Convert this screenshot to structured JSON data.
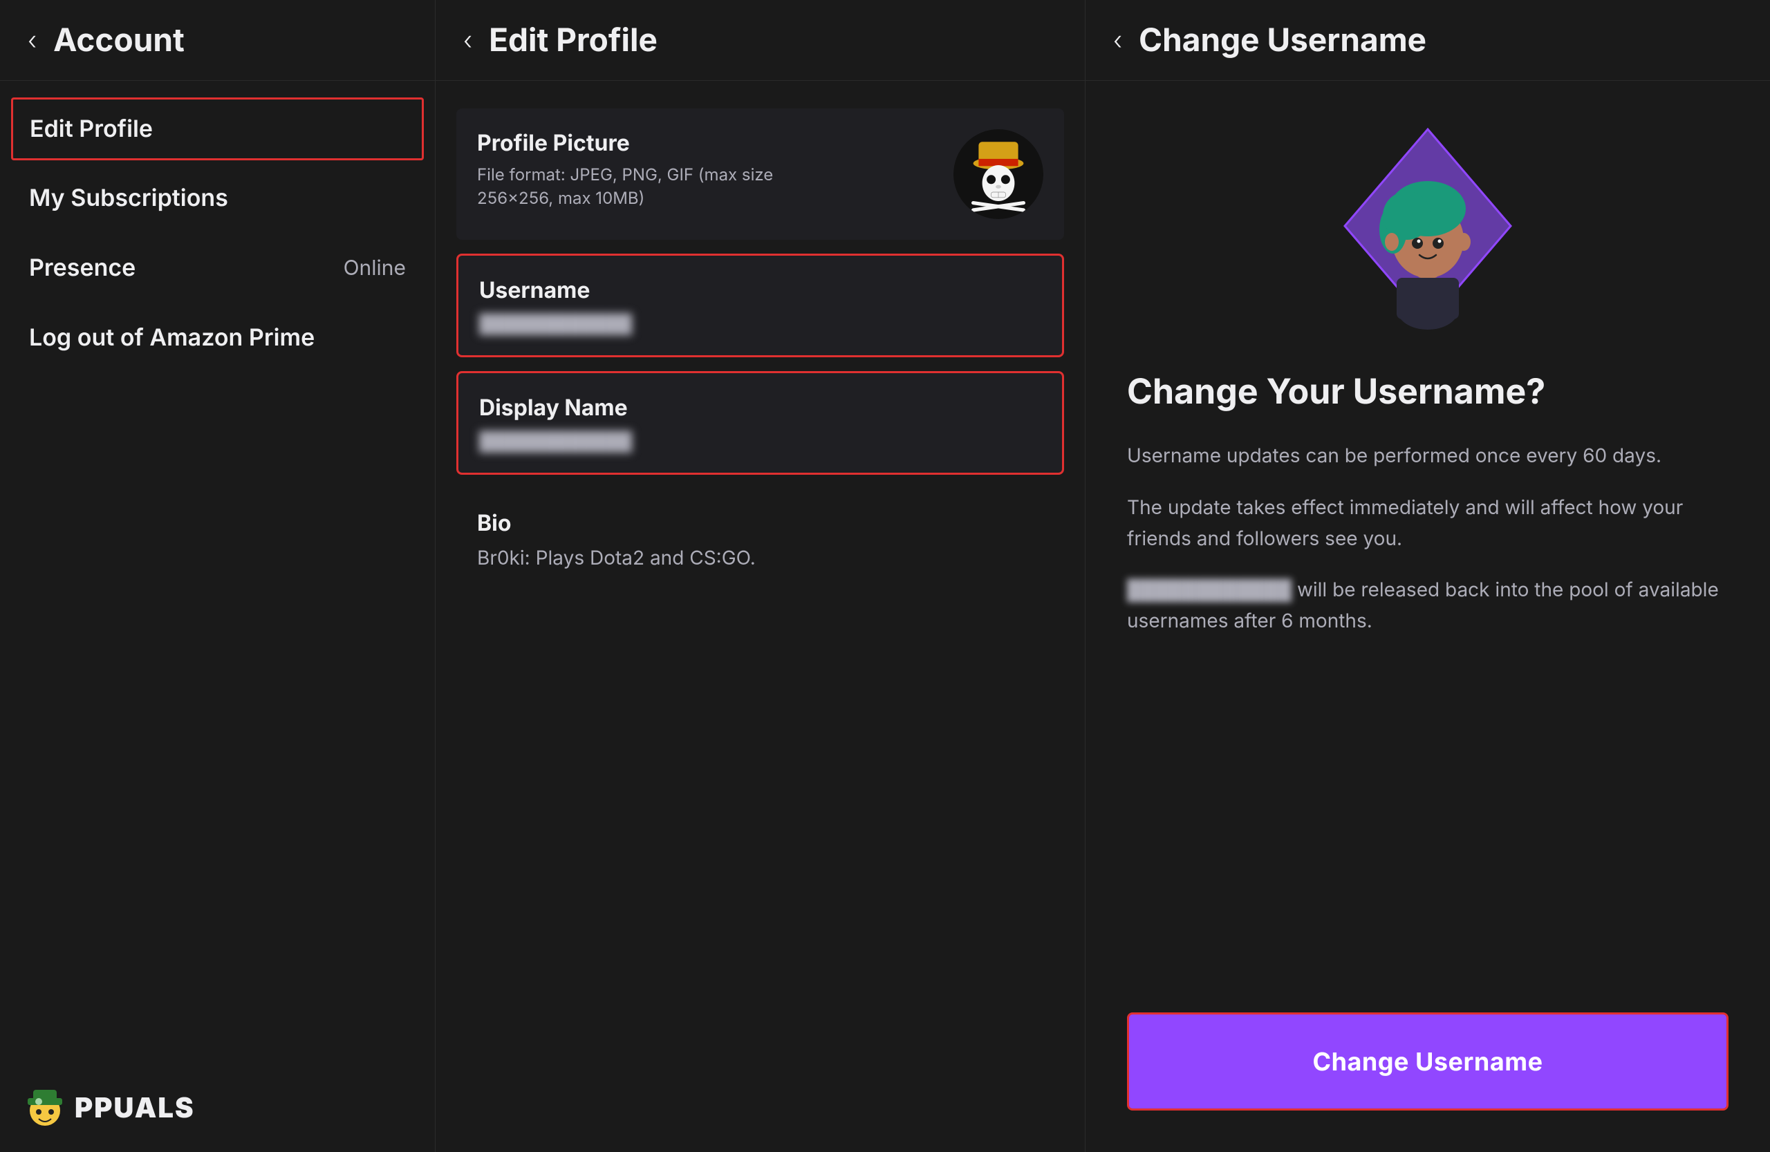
{
  "account_panel": {
    "back_label": "‹",
    "title": "Account",
    "menu_items": [
      {
        "label": "Edit Profile",
        "value": "",
        "active": true
      },
      {
        "label": "My Subscriptions",
        "value": "",
        "active": false
      },
      {
        "label": "Presence",
        "value": "Online",
        "active": false
      },
      {
        "label": "Log out of Amazon Prime",
        "value": "",
        "active": false
      }
    ]
  },
  "edit_profile_panel": {
    "back_label": "‹",
    "title": "Edit Profile",
    "profile_picture": {
      "label": "Profile Picture",
      "description": "File format: JPEG, PNG, GIF (max size 256x256, max 10MB)"
    },
    "username": {
      "label": "Username",
      "blurred_value": "████████████"
    },
    "display_name": {
      "label": "Display Name",
      "blurred_value": "████████████"
    },
    "bio": {
      "label": "Bio",
      "value": "Br0ki: Plays Dota2 and CS:GO."
    }
  },
  "change_username_panel": {
    "back_label": "‹",
    "title": "Change Username",
    "heading": "Change Your Username?",
    "paragraph1": "Username updates can be performed once every 60 days.",
    "paragraph2": "The update takes effect immediately and will affect how your friends and followers see you.",
    "paragraph3_prefix": "",
    "blurred_name": "████████████",
    "paragraph3_suffix": " will be released back into the pool of available usernames after 6 months.",
    "button_label": "Change Username"
  },
  "watermark": {
    "text": "A  PUALS"
  },
  "colors": {
    "accent_purple": "#9147ff",
    "accent_red": "#e03030",
    "bg_dark": "#1a1a1a",
    "bg_panel": "#1f1f23",
    "text_muted": "#adadb8",
    "text_main": "#efeff1"
  }
}
